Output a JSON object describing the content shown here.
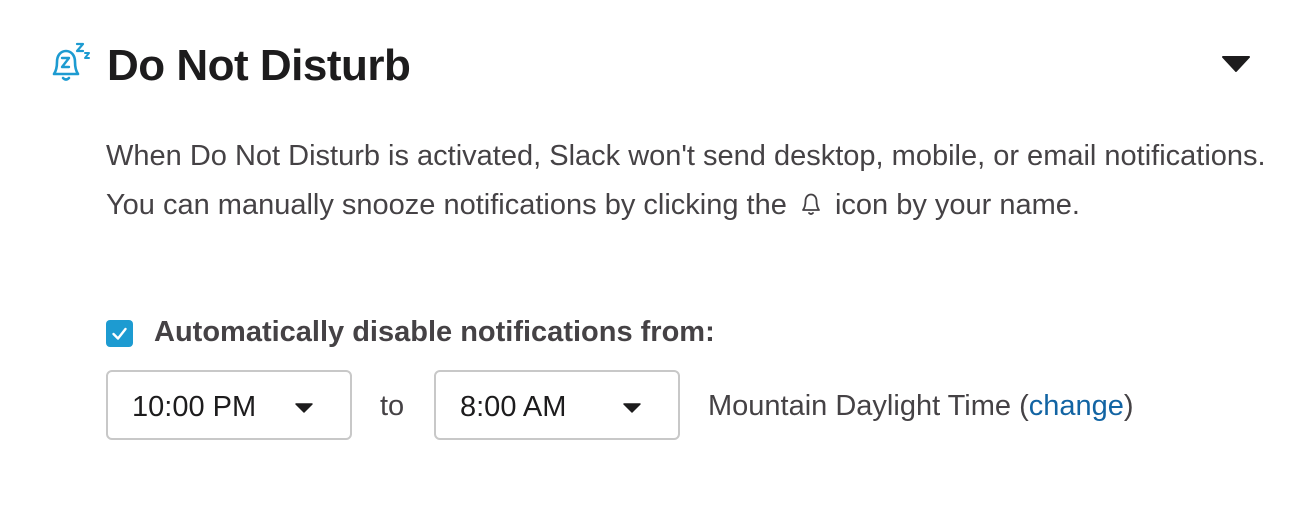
{
  "section": {
    "icon": "bell-snooze-icon",
    "title": "Do Not Disturb",
    "toggle_icon": "caret-down-icon"
  },
  "description": {
    "part1": "When Do Not Disturb is activated, Slack won't send desktop, mobile, or email notifications. You can manually snooze notifications by clicking the",
    "icon": "bell-icon",
    "part2": "icon by your name."
  },
  "auto_disable": {
    "checked": true,
    "label": "Automatically disable notifications from:"
  },
  "schedule": {
    "from_value": "10:00 PM",
    "to_label": "to",
    "to_value": "8:00 AM",
    "timezone_name": "Mountain Daylight Time",
    "tz_open_paren": "(",
    "change_link": "change",
    "tz_close_paren": ")"
  },
  "colors": {
    "accent_icon": "#1d9bd1",
    "checkbox": "#1d9bd1",
    "link": "#1264a3",
    "text": "#454245",
    "title": "#1d1c1d"
  }
}
